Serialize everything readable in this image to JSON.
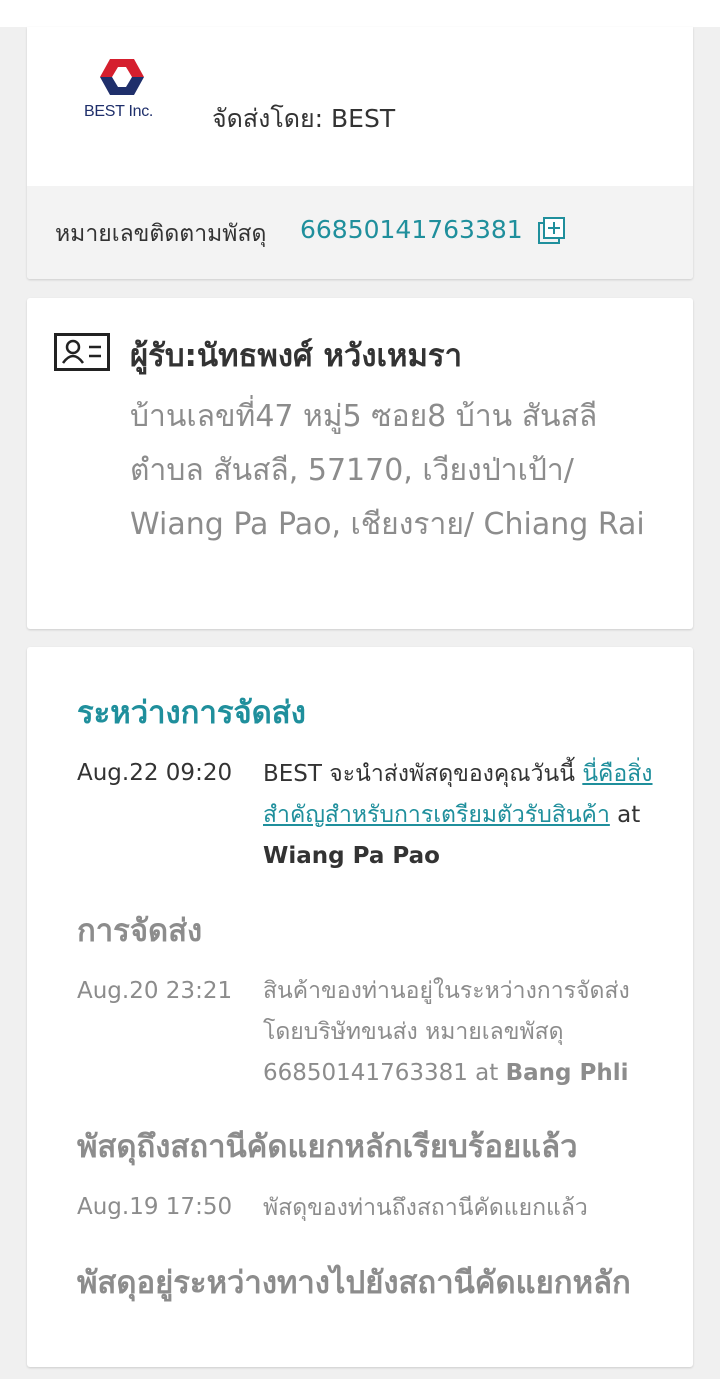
{
  "carrier": {
    "logo_text": "BEST Inc.",
    "shipped_by": "จัดส่งโดย: BEST",
    "tracking_label": "หมายเลขติดตามพัสดุ",
    "tracking_number": "66850141763381",
    "copy_icon": "copy-plus-icon"
  },
  "recipient": {
    "icon": "contact-card-icon",
    "name": "ผู้รับ:นัทธพงศ์ หวังเหมรา",
    "address": "บ้านเลขที่47 หมู่5 ซอย8 บ้าน สันสลี ตำบล สันสลี, 57170, เวียงป่าเป้า/ Wiang Pa Pao, เชียงราย/ Chiang Rai"
  },
  "timeline": [
    {
      "status": "ระหว่างการจัดส่ง",
      "time": "Aug.22 09:20",
      "desc_prefix": "BEST จะนำส่งพัสดุของคุณวันนี้ ",
      "link": "นี่คือสิ่งสำคัญสำหรับการเตรียมตัวรับสินค้า",
      "at": " at ",
      "location": "Wiang Pa Pao"
    },
    {
      "status": "การจัดส่ง",
      "time": "Aug.20 23:21",
      "desc": "สินค้าของท่านอยู่ในระหว่างการจัดส่งโดยบริษัทขนส่ง หมายเลขพัสดุ 66850141763381",
      "at": " at ",
      "location": "Bang Phli"
    },
    {
      "status": "พัสดุถึงสถานีคัดแยกหลักเรียบร้อยแล้ว",
      "time": "Aug.19 17:50",
      "desc": "พัสดุของท่านถึงสถานีคัดแยกแล้ว"
    },
    {
      "status": "พัสดุอยู่ระหว่างทางไปยังสถานีคัดแยกหลัก"
    }
  ],
  "colors": {
    "accent": "#1f8f9c",
    "muted": "#8c8c8c",
    "text": "#333333",
    "background": "#f0f0f0"
  }
}
